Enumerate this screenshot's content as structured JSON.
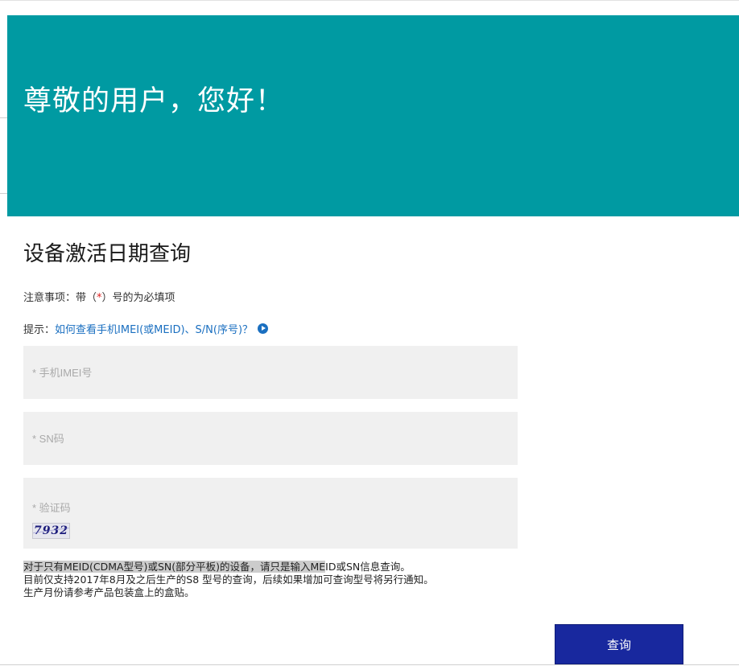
{
  "banner": {
    "title": "尊敬的用户，您好！"
  },
  "page_title": "设备激活日期查询",
  "note": {
    "prefix": "注意事项：带（",
    "star": "*",
    "suffix": "）号的为必填项"
  },
  "tip": {
    "prefix": "提示：",
    "link_text": "如何查看手机IMEI(或MEID)、S/N(序号)？"
  },
  "fields": {
    "imei_placeholder": "* 手机IMEI号",
    "sn_placeholder": "* SN码",
    "captcha_placeholder": "* 验证码"
  },
  "captcha_text": "7932",
  "info": {
    "line1_highlight": "对于只有MEID(CDMA型号)或SN(部分平板)的设备，请只是输入ME",
    "line1_rest": "ID或SN信息查询。",
    "line2": "目前仅支持2017年8月及之后生产的S8 型号的查询，后续如果增加可查询型号将另行通知。",
    "line3": "生产月份请参考产品包装盒上的盒贴。"
  },
  "query_button": "查询",
  "colors": {
    "banner": "#009aa2",
    "button": "#18289e",
    "link": "#1a6fc0",
    "required": "#e02020"
  }
}
